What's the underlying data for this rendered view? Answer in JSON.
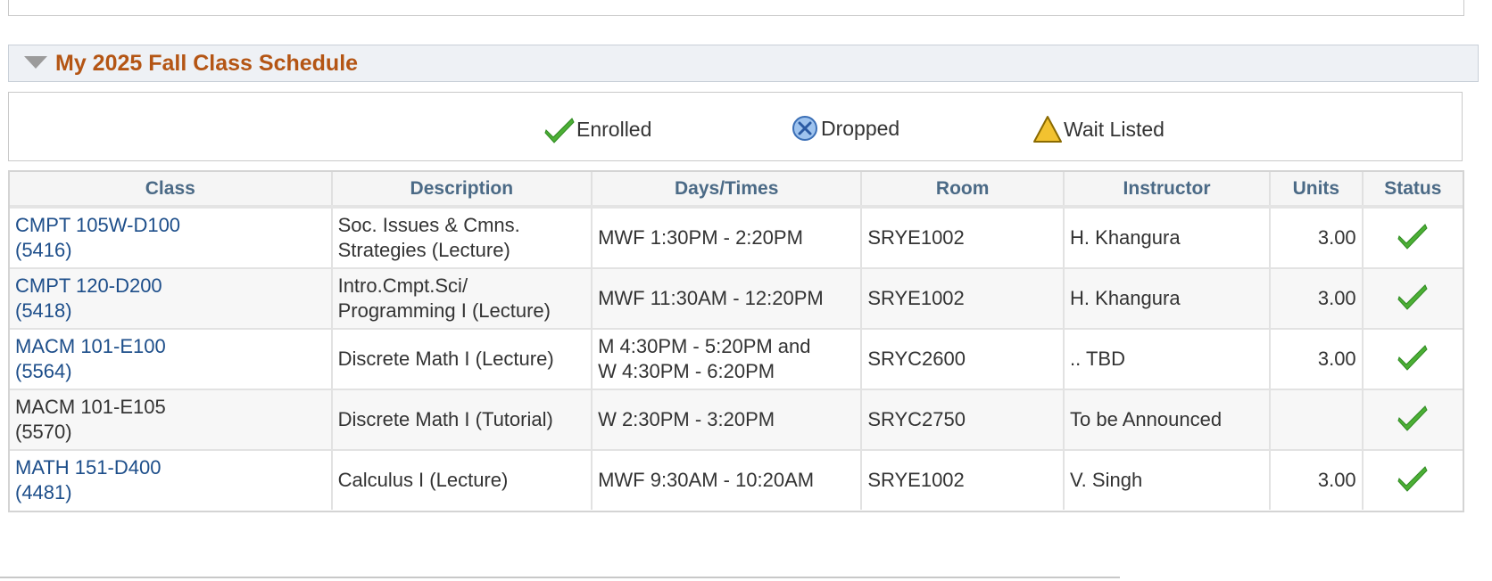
{
  "section": {
    "title": "My 2025 Fall Class Schedule"
  },
  "legend": {
    "enrolled": "Enrolled",
    "dropped": "Dropped",
    "wait_listed": "Wait Listed"
  },
  "table": {
    "headers": [
      "Class",
      "Description",
      "Days/Times",
      "Room",
      "Instructor",
      "Units",
      "Status"
    ],
    "rows": [
      {
        "class_line1": "CMPT 105W-D100",
        "class_line2": "(5416)",
        "link": true,
        "desc_line1": "Soc. Issues & Cmns.",
        "desc_line2": "Strategies (Lecture)",
        "days_line1": "MWF 1:30PM - 2:20PM",
        "days_line2": "",
        "room": "SRYE1002",
        "instructor": "H. Khangura",
        "units": "3.00",
        "status_icon": "enrolled-check-icon"
      },
      {
        "class_line1": "CMPT 120-D200",
        "class_line2": "(5418)",
        "link": true,
        "desc_line1": "Intro.Cmpt.Sci/",
        "desc_line2": "Programming I (Lecture)",
        "days_line1": "MWF 11:30AM - 12:20PM",
        "days_line2": "",
        "room": "SRYE1002",
        "instructor": "H. Khangura",
        "units": "3.00",
        "status_icon": "enrolled-check-icon"
      },
      {
        "class_line1": "MACM 101-E100",
        "class_line2": "(5564)",
        "link": true,
        "desc_line1": "Discrete Math I (Lecture)",
        "desc_line2": "",
        "days_line1": "M 4:30PM - 5:20PM and",
        "days_line2": "W 4:30PM - 6:20PM",
        "room": "SRYC2600",
        "instructor": ".. TBD",
        "units": "3.00",
        "status_icon": "enrolled-check-icon"
      },
      {
        "class_line1": "MACM 101-E105",
        "class_line2": "(5570)",
        "link": false,
        "desc_line1": "Discrete Math I (Tutorial)",
        "desc_line2": "",
        "days_line1": "W 2:30PM - 3:20PM",
        "days_line2": "",
        "room": "SRYC2750",
        "instructor": "To be Announced",
        "units": "",
        "status_icon": "enrolled-check-icon"
      },
      {
        "class_line1": "MATH 151-D400",
        "class_line2": "(4481)",
        "link": true,
        "desc_line1": "Calculus I (Lecture)",
        "desc_line2": "",
        "days_line1": "MWF 9:30AM - 10:20AM",
        "days_line2": "",
        "room": "SRYE1002",
        "instructor": "V. Singh",
        "units": "3.00",
        "status_icon": "enrolled-check-icon"
      }
    ]
  },
  "colors": {
    "title": "#b45514",
    "link": "#1d4e8a",
    "header_text": "#4b6a86",
    "check": "#4caf35"
  }
}
